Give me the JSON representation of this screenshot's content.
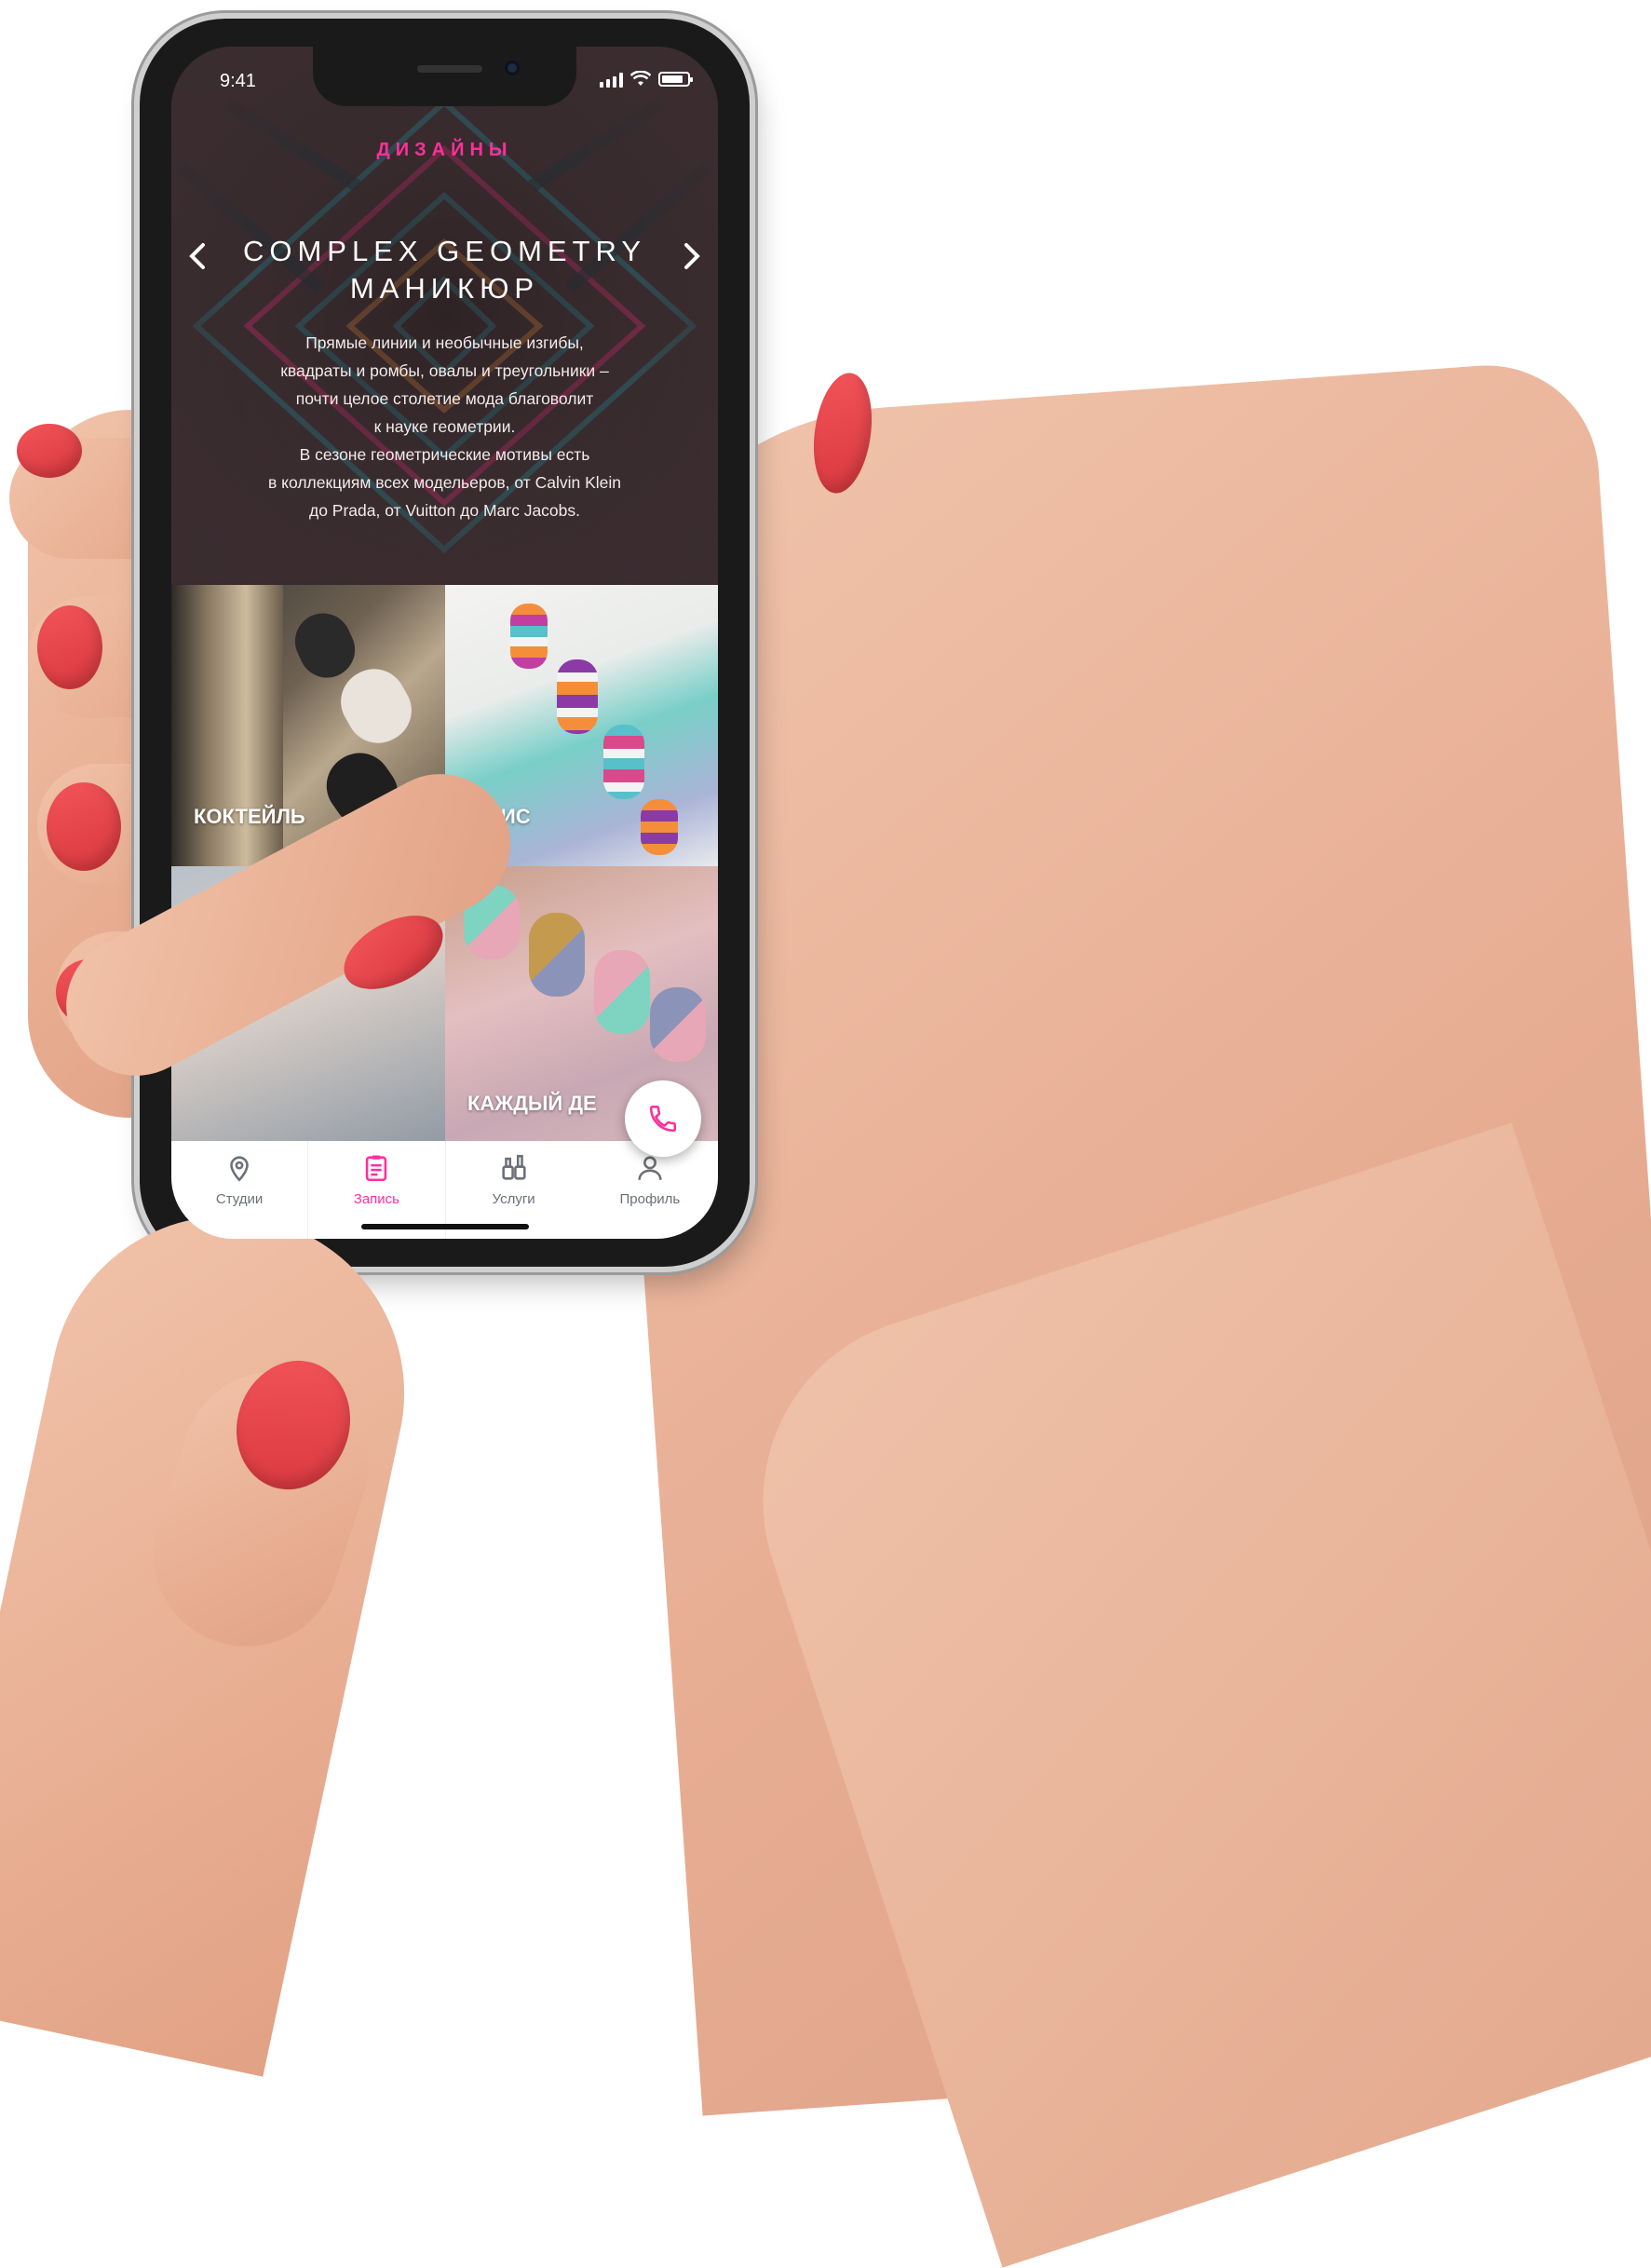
{
  "status_bar": {
    "time": "9:41",
    "battery_level": 0.85
  },
  "hero": {
    "section_label": "ДИЗАЙНЫ",
    "title_line1": "COMPLEX GEOMETRY",
    "title_line2": "МАНИКЮР",
    "prev_icon": "chevron-left-icon",
    "next_icon": "chevron-right-icon",
    "description": [
      "Прямые линии и необычные изгибы,",
      "квадраты и ромбы, овалы и треугольники –",
      "почти целое столетие мода благоволит",
      "к науке геометрии.",
      "В сезоне геометрические мотивы есть",
      "в коллекциям всех модельеров, от Calvin Klein",
      "до Prada, от Vuitton до Marc Jacobs."
    ]
  },
  "tiles": [
    {
      "label": "КОКТЕЙЛЬ"
    },
    {
      "label": "ОФИС"
    },
    {
      "label": ""
    },
    {
      "label": "КАЖДЫЙ ДЕ"
    }
  ],
  "fab": {
    "icon": "phone-icon"
  },
  "tabbar": {
    "tabs": [
      {
        "label": "Студии",
        "icon": "map-pin-icon"
      },
      {
        "label": "Запись",
        "icon": "clipboard-icon",
        "active": true
      },
      {
        "label": "Услуги",
        "icon": "nail-polish-icon"
      },
      {
        "label": "Профиль",
        "icon": "user-icon"
      }
    ]
  },
  "colors": {
    "accent": "#ff2f9b",
    "hero_bg": "#3b2d30",
    "tab_inactive": "#6b6f78",
    "nail_polish": "#e0444a"
  }
}
